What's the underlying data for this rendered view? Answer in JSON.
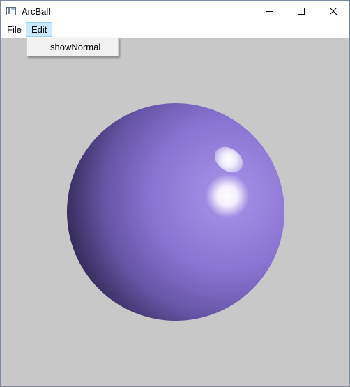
{
  "window": {
    "title": "ArcBall"
  },
  "menubar": {
    "items": [
      {
        "label": "File"
      },
      {
        "label": "Edit"
      }
    ]
  },
  "edit_menu": {
    "items": [
      {
        "label": "showNormal"
      }
    ]
  },
  "viewport": {
    "background_color": "#c8c8c8",
    "sphere_color": "#8f78d6"
  }
}
